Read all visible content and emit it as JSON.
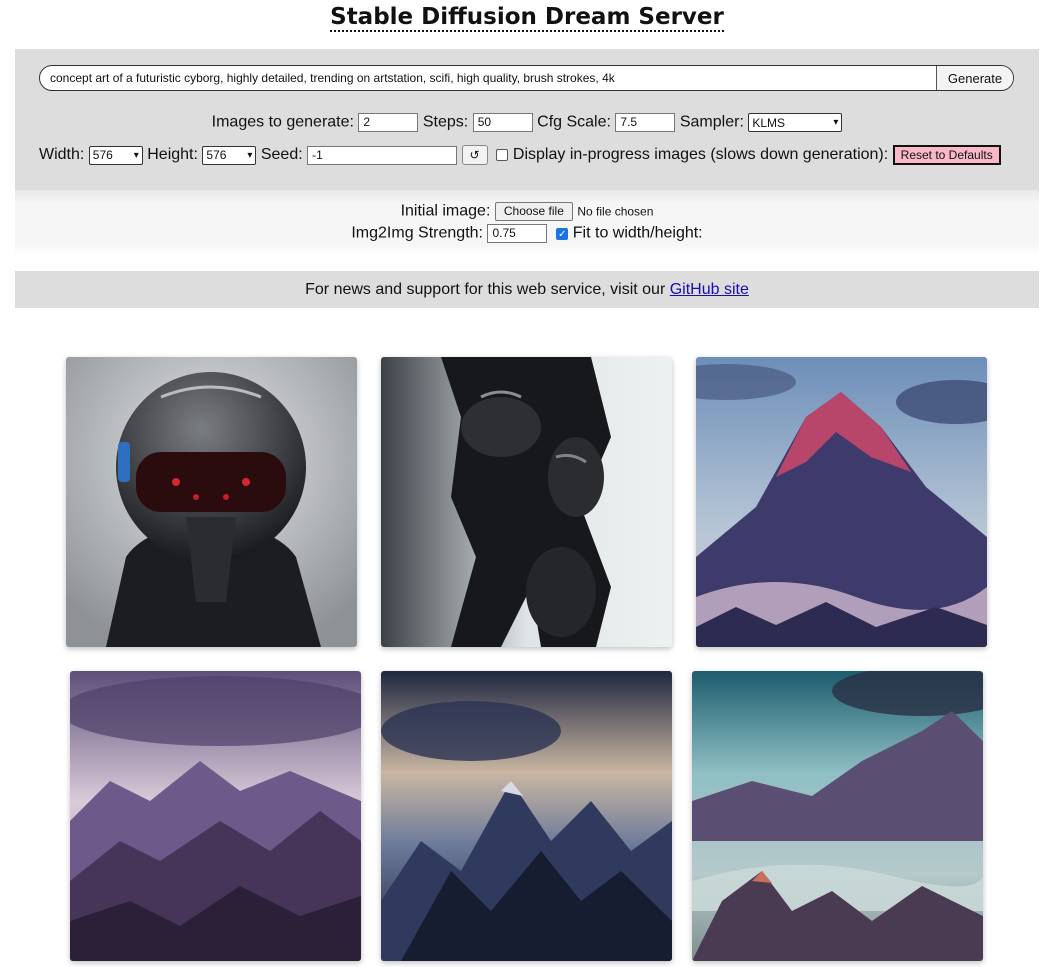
{
  "header": {
    "title": "Stable Diffusion Dream Server"
  },
  "prompt": {
    "value": "concept art of a futuristic cyborg, highly detailed, trending on artstation, scifi, high quality, brush strokes, 4k",
    "generate_label": "Generate"
  },
  "options": {
    "images_label": "Images to generate:",
    "images_value": "2",
    "steps_label": "Steps:",
    "steps_value": "50",
    "cfg_label": "Cfg Scale:",
    "cfg_value": "7.5",
    "sampler_label": "Sampler:",
    "sampler_value": "KLMS",
    "width_label": "Width:",
    "width_value": "576",
    "height_label": "Height:",
    "height_value": "576",
    "seed_label": "Seed:",
    "seed_value": "-1",
    "reroll_icon": "↺",
    "progress_label": "Display in-progress images (slows down generation):",
    "progress_checked": false,
    "reset_label": "Reset to Defaults"
  },
  "img2img": {
    "initial_label": "Initial image:",
    "choose_file_label": "Choose file",
    "no_file_text": "No file chosen",
    "strength_label": "Img2Img Strength:",
    "strength_value": "0.75",
    "fit_label": "Fit to width/height:",
    "fit_checked": true
  },
  "news": {
    "text": "For news and support for this web service, visit our",
    "link_label": "GitHub site"
  },
  "gallery": {
    "images": [
      {
        "subject": "cyborg-helmet-portrait",
        "palette": [
          "#9a9ea3",
          "#2b2d31",
          "#c0202a"
        ]
      },
      {
        "subject": "cyborg-black-figure",
        "palette": [
          "#cfd5d8",
          "#1b1c1f",
          "#6d7275"
        ]
      },
      {
        "subject": "pink-mountain-peak",
        "palette": [
          "#6f8fb5",
          "#b14a6a",
          "#3b3a6a"
        ]
      },
      {
        "subject": "purple-mountain-range",
        "palette": [
          "#8a7aa5",
          "#3a2e4f",
          "#d8c9cf"
        ]
      },
      {
        "subject": "dark-blue-mountains",
        "palette": [
          "#2f3a5c",
          "#171c2b",
          "#c8b7a8"
        ]
      },
      {
        "subject": "misty-teal-mountains",
        "palette": [
          "#1f6a7a",
          "#5a4f72",
          "#b9d3d5"
        ]
      }
    ]
  }
}
